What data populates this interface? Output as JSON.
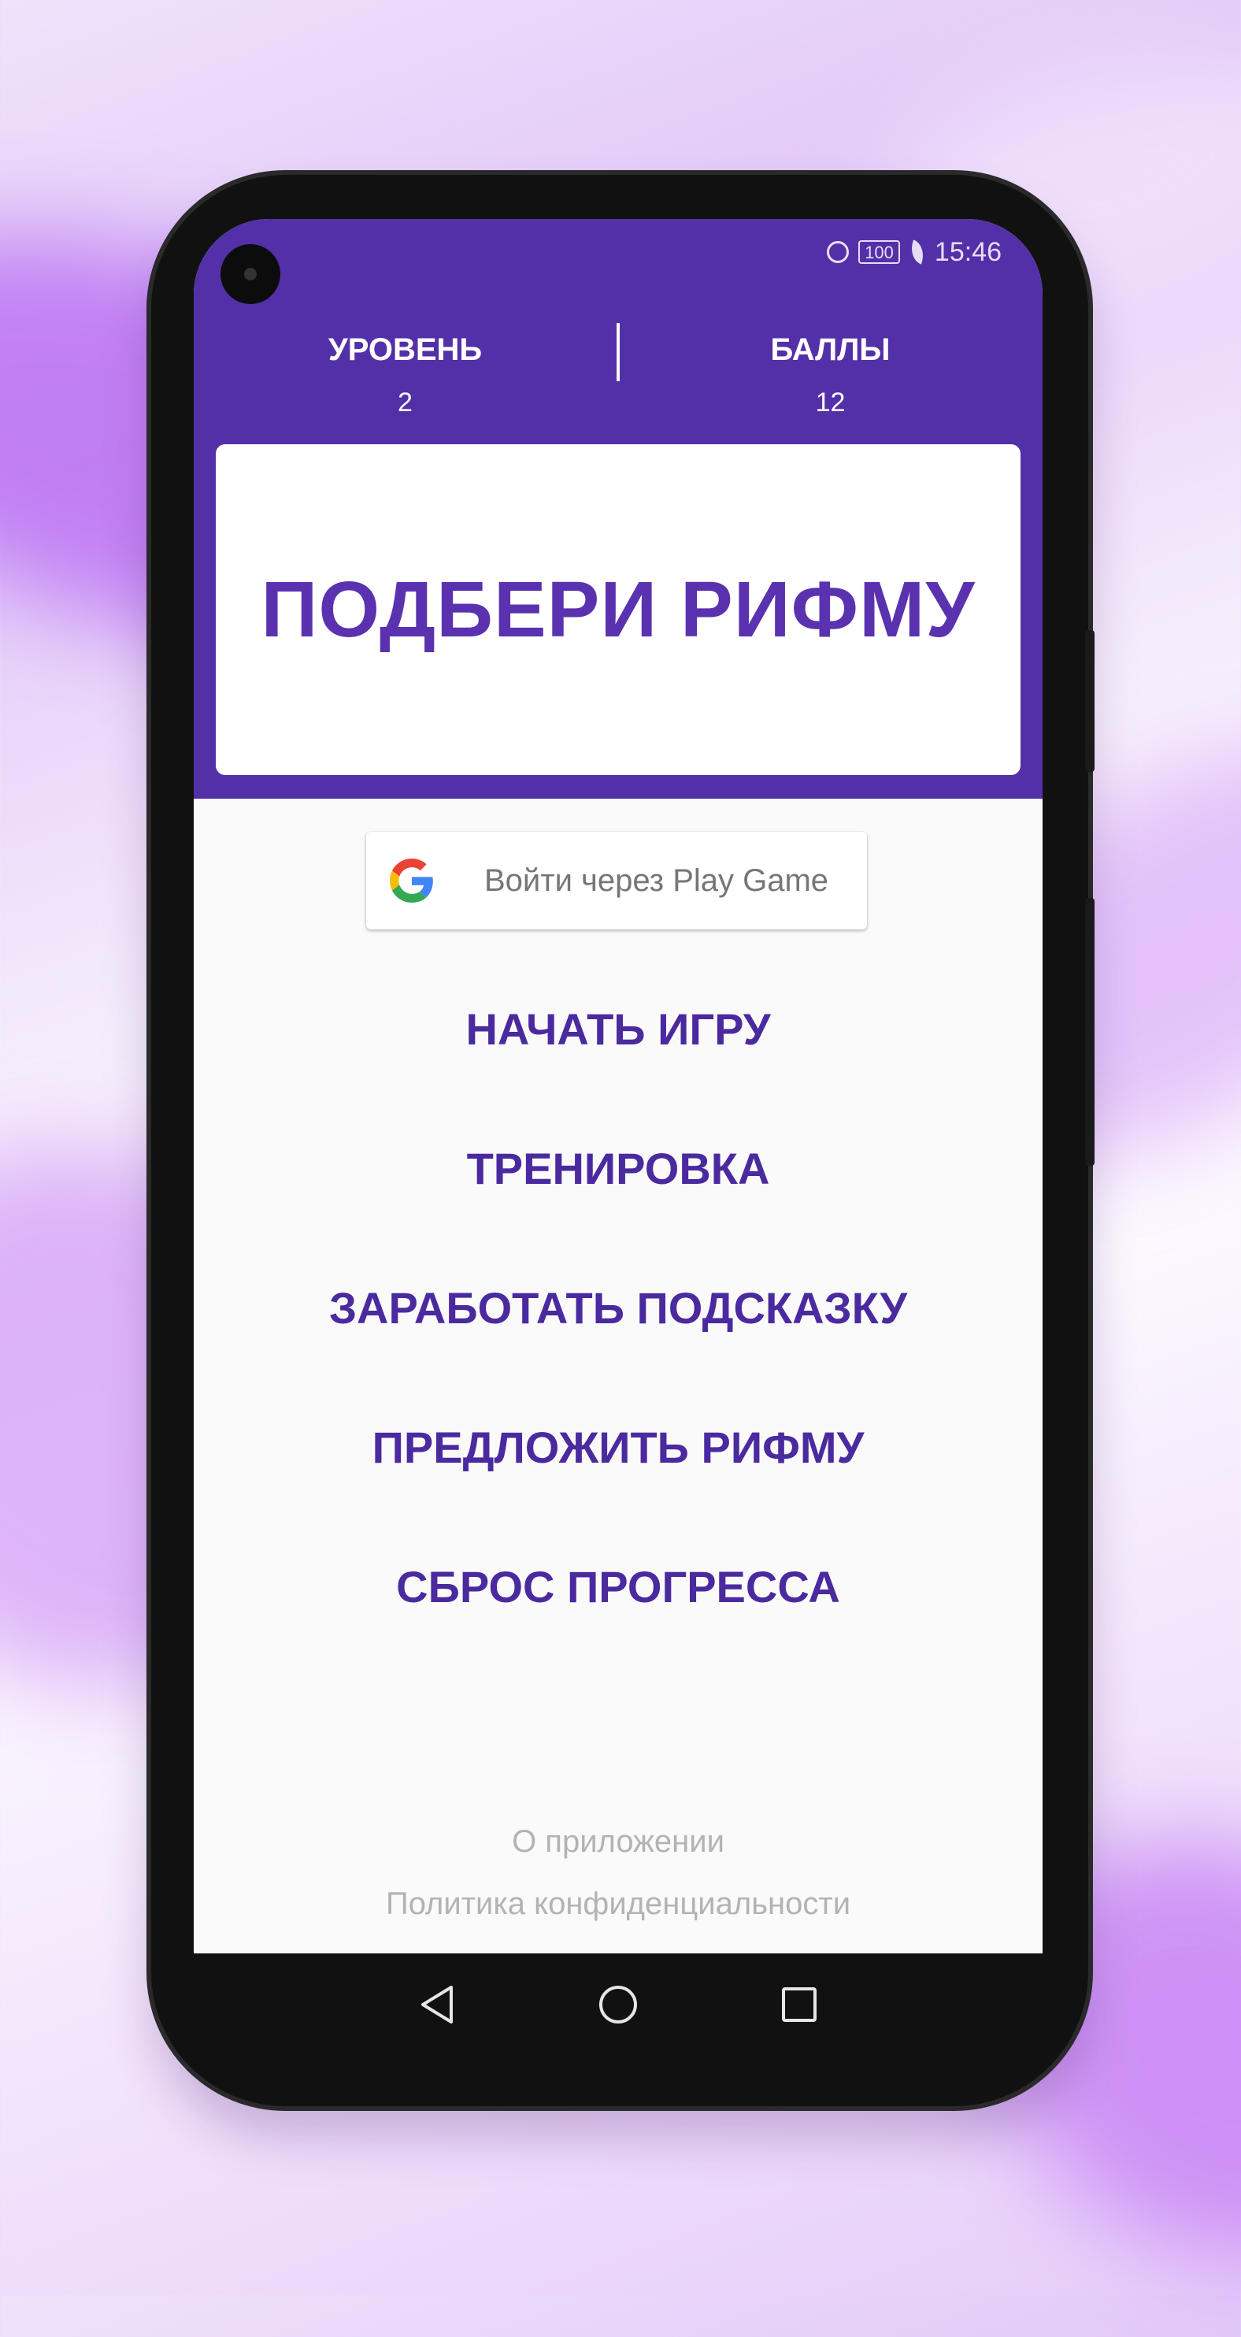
{
  "status_bar": {
    "time": "15:46",
    "battery": "100",
    "icons": [
      "alarm-icon",
      "battery-icon",
      "leaf-icon",
      "signal-icon"
    ]
  },
  "stats": {
    "level_label": "УРОВЕНЬ",
    "level_value": "2",
    "score_label": "БАЛЛЫ",
    "score_value": "12"
  },
  "title": "ПОДБЕРИ РИФМУ",
  "signin": {
    "label": "Войти через Play Game",
    "icon": "google-icon"
  },
  "menu": {
    "items": [
      "НАЧАТЬ ИГРУ",
      "ТРЕНИРОВКА",
      "ЗАРАБОТАТЬ ПОДСКАЗКУ",
      "ПРЕДЛОЖИТЬ РИФМУ",
      "СБРОС ПРОГРЕССА"
    ]
  },
  "footer": {
    "about": "О приложении",
    "privacy": "Политика конфиденциальности"
  },
  "nav": {
    "icons": [
      "back-icon",
      "home-icon",
      "recents-icon"
    ]
  },
  "colors": {
    "header": "#5330a8",
    "accent": "#4a2a9e",
    "title": "#5a32b0",
    "footer_text": "#b3b3b3"
  }
}
